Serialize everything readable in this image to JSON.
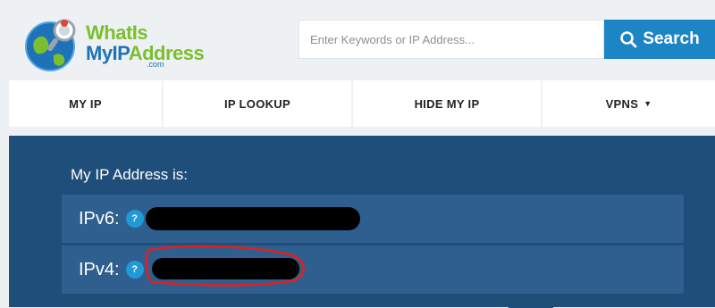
{
  "logo": {
    "line1": "WhatIs",
    "line2_my_ip": "MyIP",
    "line2_address": "Address",
    "suffix": ".com",
    "brand_green": "#7bbf2e",
    "brand_blue": "#1d72b8"
  },
  "search": {
    "placeholder": "Enter Keywords or IP Address...",
    "value": "",
    "button_label": "Search",
    "button_icon": "search-icon",
    "button_color": "#1d84c6"
  },
  "nav": {
    "items": [
      {
        "label": "MY IP"
      },
      {
        "label": "IP LOOKUP"
      },
      {
        "label": "HIDE MY IP"
      },
      {
        "label": "VPNS",
        "caret": "▼"
      }
    ]
  },
  "main": {
    "heading": "My IP Address is:",
    "background": "#1f4e7a",
    "rows": [
      {
        "label": "IPv6:",
        "help": "?"
      },
      {
        "label": "IPv4:",
        "help": "?"
      }
    ]
  }
}
